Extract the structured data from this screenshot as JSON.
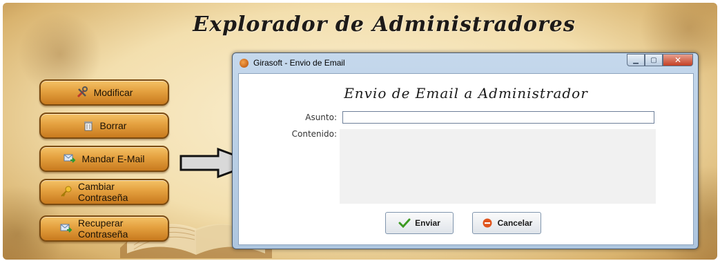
{
  "app": {
    "title": "Explorador de Administradores"
  },
  "sidebar": {
    "items": [
      {
        "label": "Modificar",
        "icon": "tools-icon"
      },
      {
        "label": "Borrar",
        "icon": "trash-icon"
      },
      {
        "label": "Mandar E-Mail",
        "icon": "mail-send-icon"
      },
      {
        "label": "Cambiar\nContraseña",
        "icon": "key-icon"
      },
      {
        "label": "Recuperar\nContraseña",
        "icon": "mail-send-icon"
      }
    ]
  },
  "dialog": {
    "title": "Girasoft - Envio de Email",
    "heading": "Envio de Email a Administrador",
    "subject_label": "Asunto:",
    "subject_value": "",
    "content_label": "Contenido:",
    "content_value": "",
    "send_label": "Enviar",
    "cancel_label": "Cancelar",
    "window_buttons": [
      "minimize-icon",
      "maximize-icon",
      "close-icon"
    ]
  },
  "colors": {
    "button_orange": "#e4a03f",
    "dialog_frame": "#aec6df",
    "close_red": "#c33f24"
  }
}
